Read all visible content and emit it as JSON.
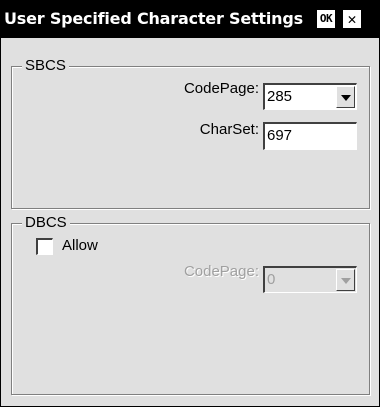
{
  "window": {
    "title": "User Specified Character Settings",
    "ok_label": "OK",
    "close_label": "✕"
  },
  "sbcs": {
    "group_label": "SBCS",
    "codepage_label": "CodePage:",
    "codepage_value": "285",
    "charset_label": "CharSet:",
    "charset_value": "697"
  },
  "dbcs": {
    "group_label": "DBCS",
    "allow_label": "Allow",
    "allow_checked": false,
    "codepage_label": "CodePage:",
    "codepage_value": "0",
    "codepage_enabled": false
  }
}
